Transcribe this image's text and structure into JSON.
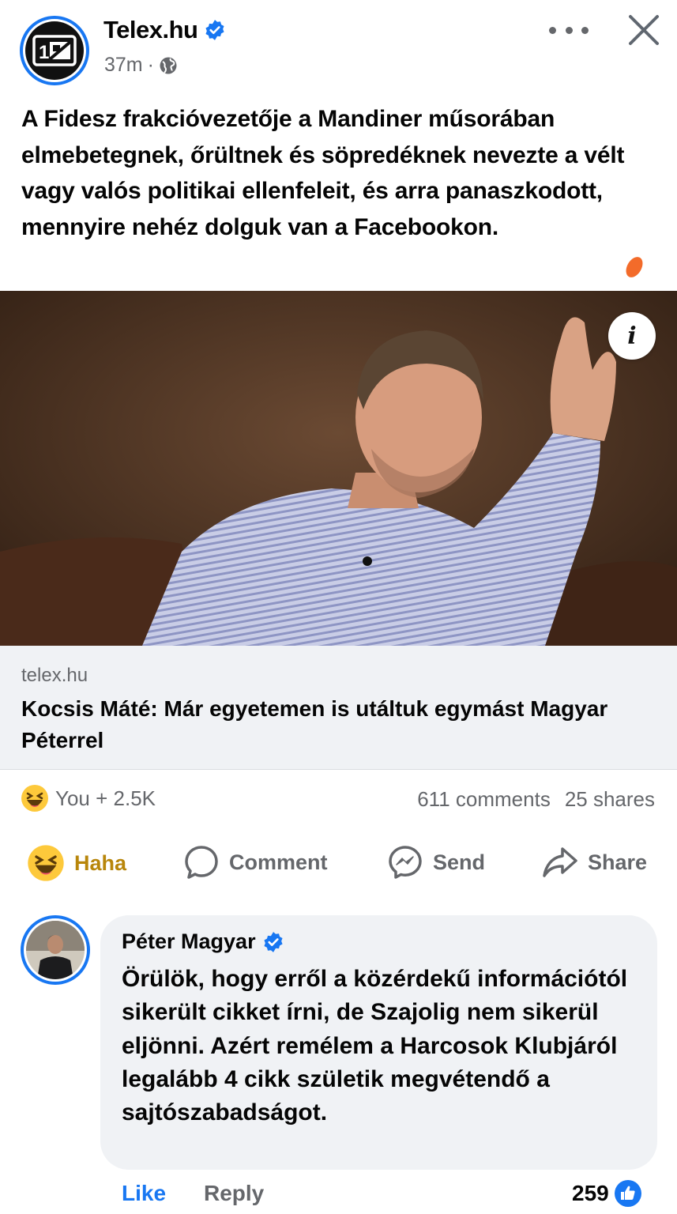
{
  "post": {
    "page_name": "Telex.hu",
    "time": "37m",
    "separator": "·",
    "text": "A Fidesz frakcióvezetője a Mandiner műsorában elmebetegnek, őrültnek és söpredéknek nevezte a vélt vagy valós politikai ellenfeleit, és arra panaszkodott, mennyire nehéz dolguk van a Facebookon.",
    "icons": {
      "avatar": "telex-logo",
      "verified": "verified-badge-icon",
      "audience": "globe-icon",
      "more": "more-dots-icon",
      "close": "close-icon"
    }
  },
  "link": {
    "domain": "telex.hu",
    "title": "Kocsis Máté: Már egyetemen is utáltuk egymást Magyar Péterrel"
  },
  "summary": {
    "reactors": "You + 2.5K",
    "comments": "611 comments",
    "shares": "25 shares"
  },
  "actions": {
    "haha": "Haha",
    "comment": "Comment",
    "send": "Send",
    "share": "Share"
  },
  "comment": {
    "author": "Péter Magyar",
    "text": "Örülök, hogy erről a közérdekű információtól sikerült cikket írni, de Szajolig nem sikerül eljönni. Azért remélem a Harcosok Klubjáról legalább 4 cikk születik megvétendő a sajtószabadságot.",
    "like_label": "Like",
    "reply_label": "Reply",
    "like_count": "259"
  },
  "colors": {
    "accent": "#1877f2",
    "muted": "#65676b",
    "haha": "#b8860b",
    "bubble_bg": "#f0f2f5"
  }
}
